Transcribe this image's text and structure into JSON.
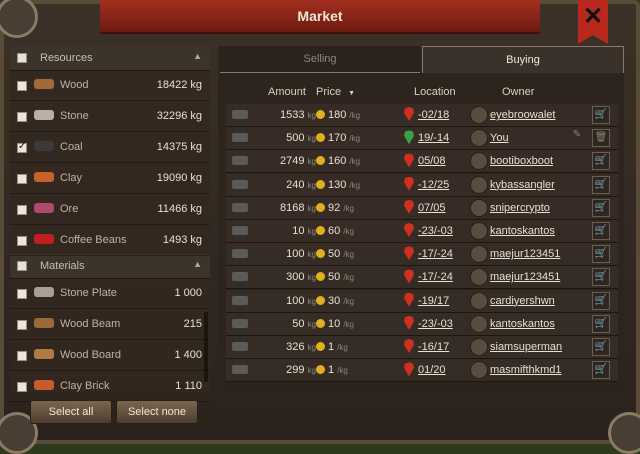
{
  "window": {
    "title": "Market",
    "close_glyph": "✕"
  },
  "sidebar": {
    "resources_header": "Resources",
    "resources": [
      {
        "label": "Wood",
        "value": "18422 kg",
        "checked": false,
        "icon": "wood-icon",
        "color": "#a06a3a"
      },
      {
        "label": "Stone",
        "value": "32296 kg",
        "checked": false,
        "icon": "stone-icon",
        "color": "#b8b0a4"
      },
      {
        "label": "Coal",
        "value": "14375 kg",
        "checked": true,
        "icon": "coal-icon",
        "color": "#3a3a3a"
      },
      {
        "label": "Clay",
        "value": "19090 kg",
        "checked": false,
        "icon": "clay-icon",
        "color": "#c8602c"
      },
      {
        "label": "Ore",
        "value": "11466 kg",
        "checked": false,
        "icon": "ore-icon",
        "color": "#b04870"
      },
      {
        "label": "Coffee Beans",
        "value": "1493 kg",
        "checked": false,
        "icon": "coffee-beans-icon",
        "color": "#c02020"
      }
    ],
    "materials_header": "Materials",
    "materials": [
      {
        "label": "Stone Plate",
        "value": "1 000",
        "icon": "stone-plate-icon",
        "color": "#a8a098"
      },
      {
        "label": "Wood Beam",
        "value": "215",
        "icon": "wood-beam-icon",
        "color": "#9a6a3a"
      },
      {
        "label": "Wood Board",
        "value": "1 400",
        "icon": "wood-board-icon",
        "color": "#b07a48"
      },
      {
        "label": "Clay Brick",
        "value": "1 110",
        "icon": "clay-brick-icon",
        "color": "#c85a30"
      }
    ],
    "select_all": "Select all",
    "select_none": "Select none"
  },
  "tabs": {
    "selling": "Selling",
    "buying": "Buying",
    "active": "buying"
  },
  "columns": {
    "amount": "Amount",
    "price": "Price",
    "location": "Location",
    "owner": "Owner",
    "sort_icon": "▼"
  },
  "unit_kg": "kg",
  "unit_per_kg": "/kg",
  "rows": [
    {
      "amount": "1533",
      "price": "180",
      "location": "-02/18",
      "owner": "eyebroowalet",
      "own": false
    },
    {
      "amount": "500",
      "price": "170",
      "location": "19/-14",
      "owner": "You",
      "own": true
    },
    {
      "amount": "2749",
      "price": "160",
      "location": "05/08",
      "owner": "bootiboxboot",
      "own": false
    },
    {
      "amount": "240",
      "price": "130",
      "location": "-12/25",
      "owner": "kybassangler",
      "own": false
    },
    {
      "amount": "8168",
      "price": "92",
      "location": "07/05",
      "owner": "snipercrypto",
      "own": false
    },
    {
      "amount": "10",
      "price": "60",
      "location": "-23/-03",
      "owner": "kantoskantos",
      "own": false
    },
    {
      "amount": "100",
      "price": "50",
      "location": "-17/-24",
      "owner": "maejur123451",
      "own": false
    },
    {
      "amount": "300",
      "price": "50",
      "location": "-17/-24",
      "owner": "maejur123451",
      "own": false
    },
    {
      "amount": "100",
      "price": "30",
      "location": "-19/17",
      "owner": "cardiyershwn",
      "own": false
    },
    {
      "amount": "50",
      "price": "10",
      "location": "-23/-03",
      "owner": "kantoskantos",
      "own": false
    },
    {
      "amount": "326",
      "price": "1",
      "location": "-16/17",
      "owner": "siamsuperman",
      "own": false
    },
    {
      "amount": "299",
      "price": "1",
      "location": "01/20",
      "owner": "masmifthkmd1",
      "own": false
    }
  ],
  "icons": {
    "cart": "🛒",
    "edit": "✎",
    "delete": "🗑"
  }
}
